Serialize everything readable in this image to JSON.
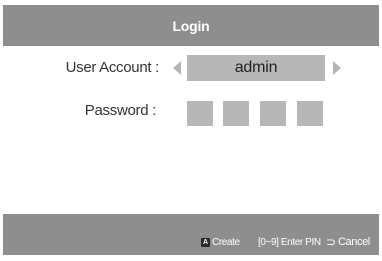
{
  "dialog": {
    "title": "Login"
  },
  "form": {
    "user_account_label": "User Account :",
    "user_account_value": "admin",
    "password_label": "Password :",
    "pin_length": 4
  },
  "footer": {
    "create_button_glyph": "A",
    "create_label": "Create",
    "enter_pin_hint": "[0~9] Enter PIN",
    "return_icon_glyph": "⊃",
    "cancel_label": "Cancel"
  },
  "colors": {
    "bar_gray": "#8e8e8e",
    "field_gray": "#b7b7b7",
    "arrow_gray": "#b5b5b5",
    "text_dark": "#333333",
    "a_button": "#2a2a2a"
  },
  "icons": {
    "left_arrow": "triangle-left-icon",
    "right_arrow": "triangle-right-icon",
    "a_button": "a-button-icon",
    "return": "return-icon"
  }
}
